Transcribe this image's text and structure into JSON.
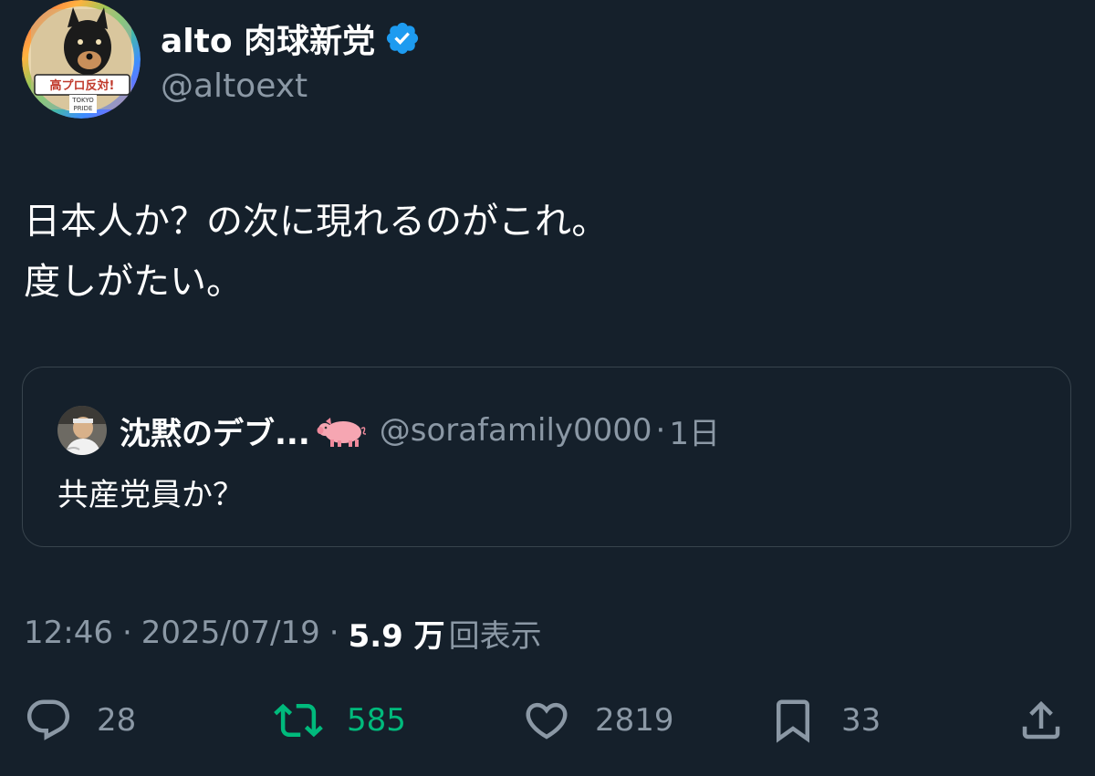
{
  "author": {
    "display_name": "alto 肉球新党",
    "handle": "@altoext",
    "verified": true,
    "avatar_badge_text": "高プロ反対!",
    "avatar_sub_text_1": "TOKYO",
    "avatar_sub_text_2": "PRIDE"
  },
  "tweet": {
    "lines": [
      "日本人か？の次に現れるのがこれ。",
      "度しがたい。"
    ]
  },
  "quote": {
    "display_name": "沈黙のデブ...",
    "name_emoji": "pig-icon",
    "handle": "@sorafamily0000",
    "dot": "·",
    "time": "1日",
    "text": "共産党員か？"
  },
  "meta": {
    "time": "12:46",
    "sep1": "·",
    "date": "2025/07/19",
    "sep2": "·",
    "views_count": "5.9 万",
    "views_label": "回表示"
  },
  "actions": {
    "reply": {
      "icon": "reply-icon",
      "count": "28"
    },
    "retweet": {
      "icon": "retweet-icon",
      "count": "585",
      "color": "#00ba7c"
    },
    "like": {
      "icon": "heart-icon",
      "count": "2819"
    },
    "bookmark": {
      "icon": "bookmark-icon",
      "count": "33"
    },
    "share": {
      "icon": "share-icon"
    }
  },
  "colors": {
    "background": "#15202b",
    "secondary_text": "#8b98a5",
    "border": "#38444d",
    "verified": "#1d9bf0"
  }
}
